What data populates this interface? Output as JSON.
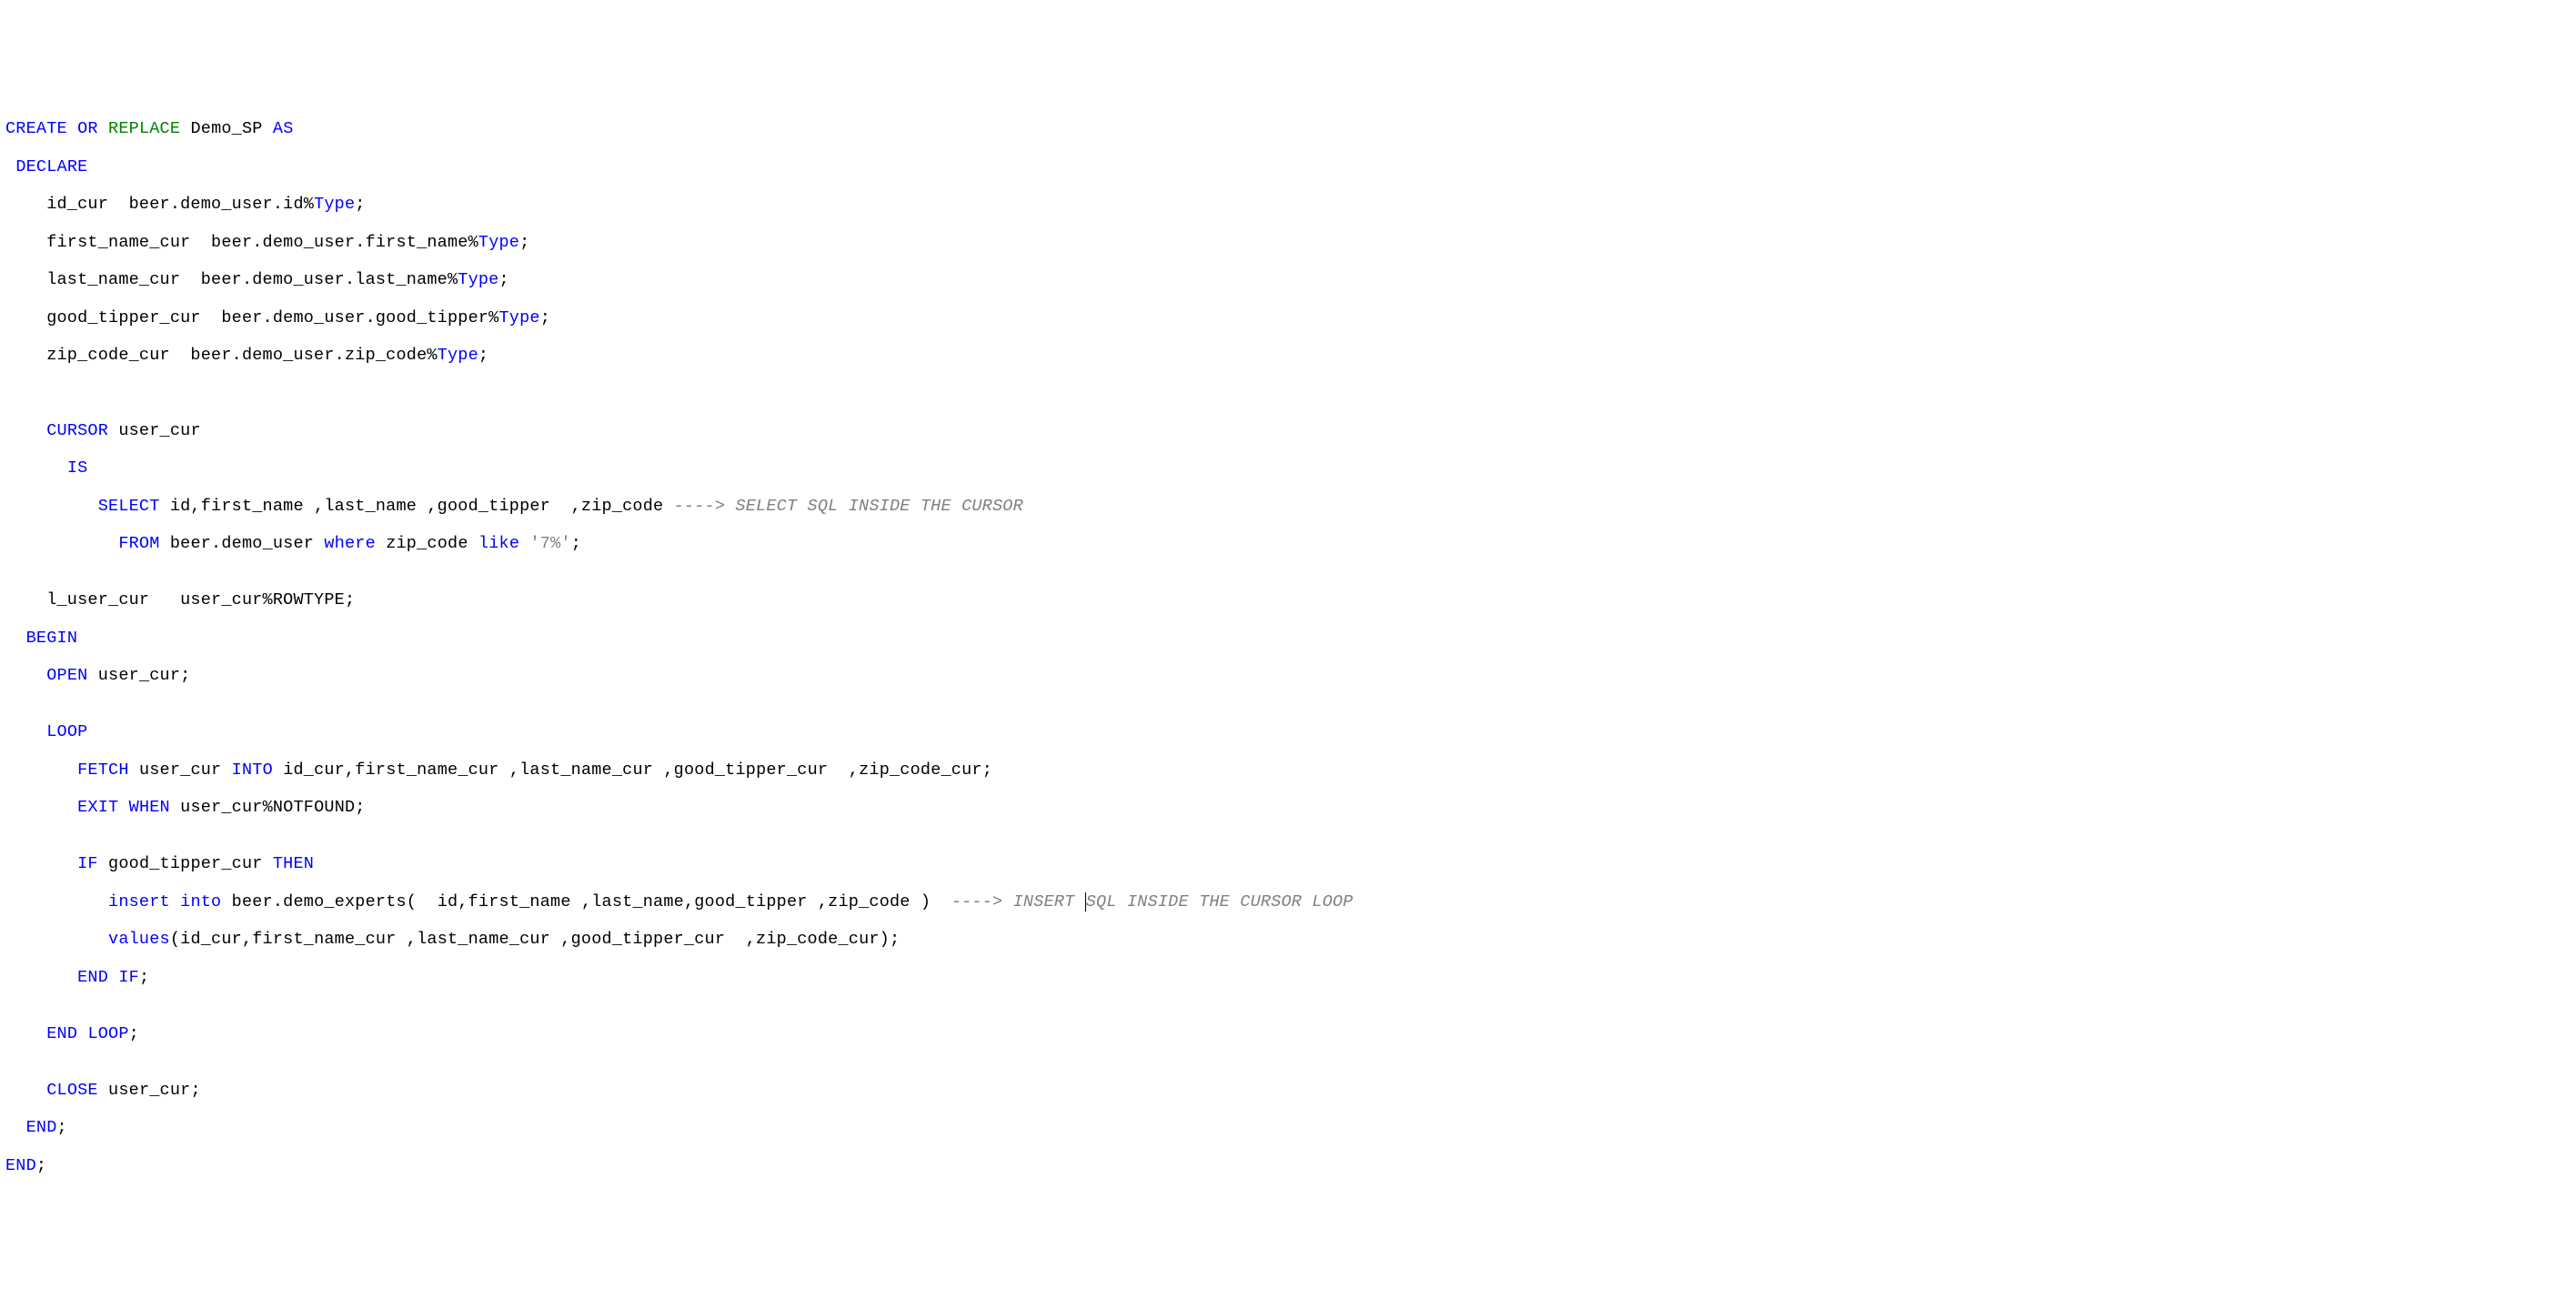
{
  "code": {
    "blank0": "",
    "line1": {
      "t1": "CREATE",
      "t2": " ",
      "t3": "OR",
      "t4": " ",
      "t5": "REPLACE",
      "t6": " Demo_SP ",
      "t7": "AS"
    },
    "line2": {
      "t1": " ",
      "t2": "DECLARE"
    },
    "line3": {
      "t1": "    id_cur  beer.demo_user.id%",
      "t2": "Type",
      "t3": ";"
    },
    "line4": {
      "t1": "    first_name_cur  beer.demo_user.first_name%",
      "t2": "Type",
      "t3": ";"
    },
    "line5": {
      "t1": "    last_name_cur  beer.demo_user.last_name%",
      "t2": "Type",
      "t3": ";"
    },
    "line6": {
      "t1": "    good_tipper_cur  beer.demo_user.good_tipper%",
      "t2": "Type",
      "t3": ";"
    },
    "line7": {
      "t1": "    zip_code_cur  beer.demo_user.zip_code%",
      "t2": "Type",
      "t3": ";"
    },
    "blank1": "",
    "blank2": "",
    "line8": {
      "t1": "    ",
      "t2": "CURSOR",
      "t3": " user_cur"
    },
    "line9": {
      "t1": "      ",
      "t2": "IS"
    },
    "line10": {
      "t1": "         ",
      "t2": "SELECT",
      "t3": " id,first_name ,last_name ,good_tipper  ,zip_code ",
      "t4": "----> SELECT SQL INSIDE THE CURSOR"
    },
    "line11": {
      "t1": "           ",
      "t2": "FROM",
      "t3": " beer.demo_user ",
      "t4": "where",
      "t5": " zip_code ",
      "t6": "like",
      "t7": " ",
      "t8": "'7%'",
      "t9": ";"
    },
    "blank3": "",
    "line12": {
      "t1": "    l_user_cur   user_cur%ROWTYPE;"
    },
    "line13": {
      "t1": "  ",
      "t2": "BEGIN"
    },
    "line14": {
      "t1": "    ",
      "t2": "OPEN",
      "t3": " user_cur;"
    },
    "blank4": "",
    "line15": {
      "t1": "    ",
      "t2": "LOOP"
    },
    "line16": {
      "t1": "       ",
      "t2": "FETCH",
      "t3": " user_cur ",
      "t4": "INTO",
      "t5": " id_cur,first_name_cur ,last_name_cur ,good_tipper_cur  ,zip_code_cur;"
    },
    "line17": {
      "t1": "       ",
      "t2": "EXIT",
      "t3": " ",
      "t4": "WHEN",
      "t5": " user_cur%NOTFOUND;"
    },
    "blank5": "",
    "line18": {
      "t1": "       ",
      "t2": "IF",
      "t3": " good_tipper_cur ",
      "t4": "THEN"
    },
    "line19": {
      "t1": "          ",
      "t2": "insert",
      "t3": " ",
      "t4": "into",
      "t5": " beer.demo_experts(  id,first_name ,last_name,good_tipper ,zip_code )  ",
      "t6a": "----> INSERT ",
      "t6b": "SQL INSIDE THE CURSOR LOOP"
    },
    "line20": {
      "t1": "          ",
      "t2": "values",
      "t3": "(id_cur,first_name_cur ,last_name_cur ,good_tipper_cur  ,zip_code_cur);"
    },
    "line21": {
      "t1": "       ",
      "t2": "END",
      "t3": " ",
      "t4": "IF",
      "t5": ";"
    },
    "blank6": "",
    "line22": {
      "t1": "    ",
      "t2": "END",
      "t3": " ",
      "t4": "LOOP",
      "t5": ";"
    },
    "blank7": "",
    "line23": {
      "t1": "    ",
      "t2": "CLOSE",
      "t3": " user_cur;"
    },
    "line24": {
      "t1": "  ",
      "t2": "END",
      "t3": ";"
    },
    "line25": {
      "t1": "END",
      "t2": ";"
    }
  }
}
